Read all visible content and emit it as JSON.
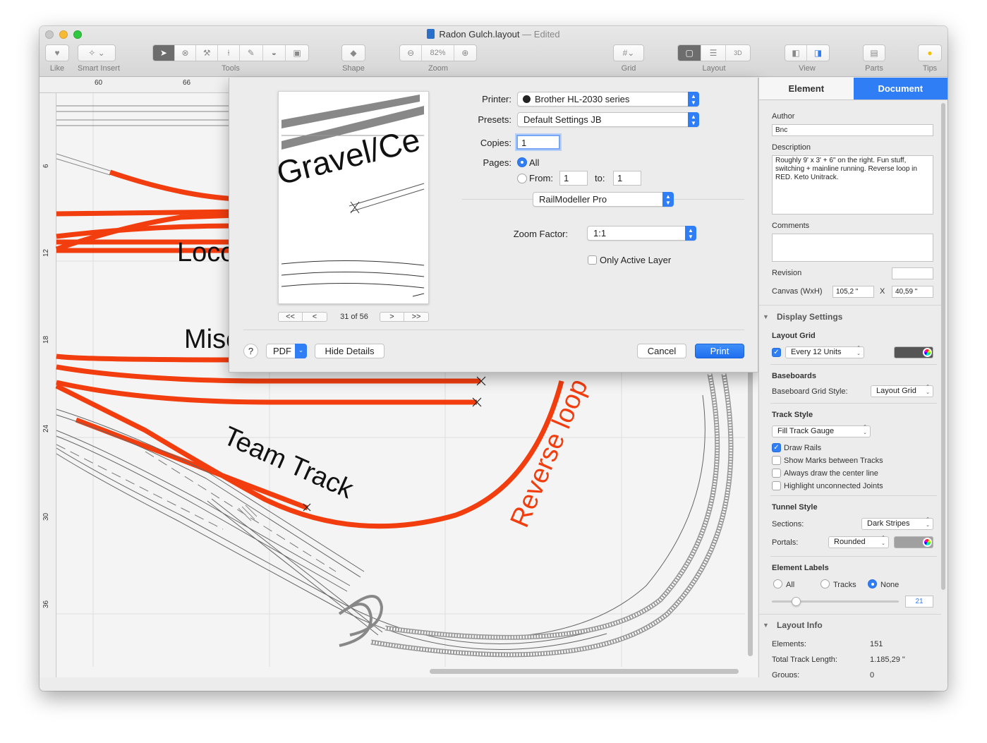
{
  "window": {
    "title": "Radon Gulch.layout",
    "title_sep": "—",
    "status": "Edited"
  },
  "toolbar": {
    "like": "Like",
    "smart_insert": "Smart Insert",
    "tools": "Tools",
    "shape": "Shape",
    "zoom_value": "82%",
    "zoom": "Zoom",
    "grid": "Grid",
    "layout": "Layout",
    "view": "View",
    "parts": "Parts",
    "tips": "Tips"
  },
  "ruler": {
    "top": [
      "60",
      "66"
    ],
    "left": [
      "6",
      "12",
      "18",
      "24",
      "30",
      "36"
    ]
  },
  "canvas_labels": {
    "loco": "Loco",
    "misc": "Misc",
    "team_track": "Team Track",
    "reverse_loop": "Reverse loop"
  },
  "print": {
    "preview_text": "Gravel/Ce",
    "pager": {
      "first": "<<",
      "prev": "<",
      "next": ">",
      "last": ">>",
      "count": "31 of 56"
    },
    "printer_label": "Printer:",
    "printer_value": "Brother HL-2030 series",
    "presets_label": "Presets:",
    "presets_value": "Default Settings JB",
    "copies_label": "Copies:",
    "copies_value": "1",
    "pages_label": "Pages:",
    "pages_all": "All",
    "pages_from": "From:",
    "pages_from_value": "1",
    "pages_to": "to:",
    "pages_to_value": "1",
    "app_section": "RailModeller Pro",
    "zoom_label": "Zoom Factor:",
    "zoom_value": "1:1",
    "only_active_layer": "Only Active Layer",
    "help": "?",
    "pdf": "PDF",
    "hide_details": "Hide Details",
    "cancel": "Cancel",
    "print": "Print"
  },
  "inspector": {
    "tab_element": "Element",
    "tab_document": "Document",
    "author_label": "Author",
    "author_value": "Bnc",
    "description_label": "Description",
    "description_value": "Roughly 9' x 3' + 6\" on the right.  Fun stuff, switching + mainline running.  Reverse loop in RED. Keto Unitrack.",
    "comments_label": "Comments",
    "comments_value": "",
    "revision_label": "Revision",
    "revision_value": "",
    "canvas_label": "Canvas (WxH)",
    "canvas_w": "105,2 \"",
    "canvas_x": "X",
    "canvas_h": "40,59 \"",
    "display_settings": "Display Settings",
    "layout_grid": "Layout Grid",
    "grid_units": "Every 12 Units",
    "grid_color": "#555555",
    "baseboards": "Baseboards",
    "baseboard_style_label": "Baseboard Grid Style:",
    "baseboard_style_value": "Layout Grid",
    "track_style": "Track Style",
    "track_style_value": "Fill Track Gauge",
    "draw_rails": "Draw Rails",
    "show_marks": "Show Marks between Tracks",
    "center_line": "Always draw the center line",
    "highlight_joints": "Highlight unconnected Joints",
    "tunnel_style": "Tunnel Style",
    "sections_label": "Sections:",
    "sections_value": "Dark Stripes",
    "portals_label": "Portals:",
    "portals_value": "Rounded",
    "portal_color": "#a0a0a0",
    "element_labels": "Element Labels",
    "labels_all": "All",
    "labels_tracks": "Tracks",
    "labels_none": "None",
    "label_size": "21",
    "layout_info": "Layout Info",
    "elements_label": "Elements:",
    "elements_value": "151",
    "track_length_label": "Total Track Length:",
    "track_length_value": "1.185,29 \"",
    "groups_label": "Groups:",
    "groups_value": "0"
  },
  "colors": {
    "track_red": "#f23d0f",
    "accent": "#2f7ef6"
  }
}
